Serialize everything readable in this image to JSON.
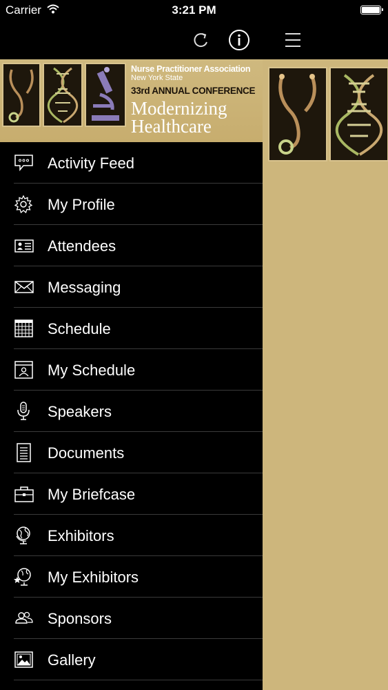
{
  "status_bar": {
    "carrier": "Carrier",
    "time": "3:21 PM"
  },
  "toolbar": {
    "refresh_icon": "refresh-icon",
    "info_icon": "info-icon",
    "menu_icon": "hamburger-menu-icon"
  },
  "banner": {
    "line1": "Nurse Practitioner Association",
    "line2": "New York State",
    "line3": "33rd ANNUAL CONFERENCE",
    "line4a": "Modernizing",
    "line4b": "Healthcare"
  },
  "menu": {
    "items": [
      {
        "label": "Activity Feed",
        "icon": "chat-bubble-icon"
      },
      {
        "label": "My Profile",
        "icon": "gear-icon"
      },
      {
        "label": "Attendees",
        "icon": "id-card-icon"
      },
      {
        "label": "Messaging",
        "icon": "envelope-icon"
      },
      {
        "label": "Schedule",
        "icon": "calendar-grid-icon"
      },
      {
        "label": "My Schedule",
        "icon": "personal-calendar-icon"
      },
      {
        "label": "Speakers",
        "icon": "microphone-icon"
      },
      {
        "label": "Documents",
        "icon": "document-icon"
      },
      {
        "label": "My Briefcase",
        "icon": "briefcase-icon"
      },
      {
        "label": "Exhibitors",
        "icon": "globe-icon"
      },
      {
        "label": "My Exhibitors",
        "icon": "starred-globe-icon"
      },
      {
        "label": "Sponsors",
        "icon": "people-icon"
      },
      {
        "label": "Gallery",
        "icon": "picture-icon"
      }
    ]
  },
  "colors": {
    "background": "#000000",
    "banner": "#cdb67c",
    "separator": "#3b3b3b",
    "text": "#ffffff"
  }
}
